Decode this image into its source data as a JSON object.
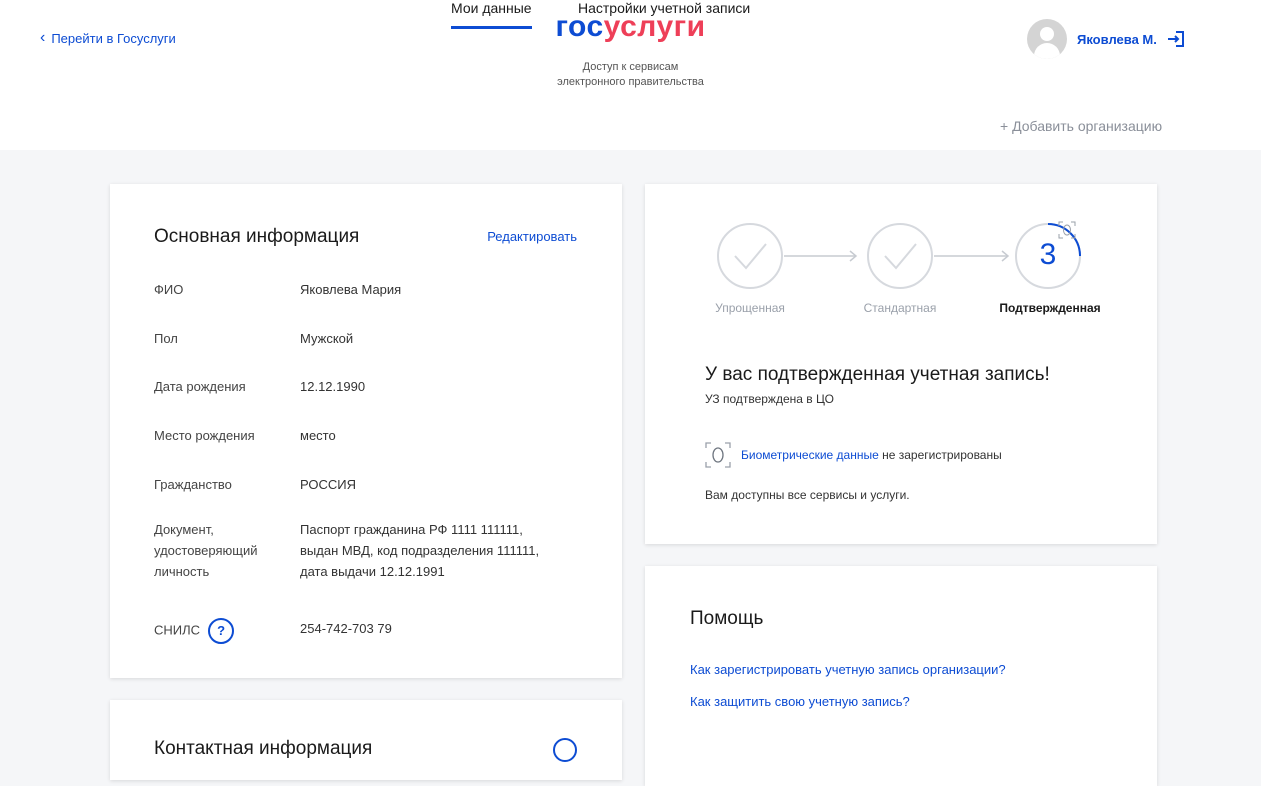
{
  "header": {
    "back_label": "Перейти в Госуслуги",
    "logo_part1": "гос",
    "logo_part2": "услуги",
    "subtitle_line1": "Доступ к сервисам",
    "subtitle_line2": "электронного правительства",
    "user_name": "Яковлева М."
  },
  "tabs": [
    {
      "label": "Мои данные",
      "active": true
    },
    {
      "label": "Настройки учетной записи",
      "active": false
    }
  ],
  "add_org_label": "+ Добавить организацию",
  "main_info": {
    "title": "Основная информация",
    "edit_label": "Редактировать",
    "fields": [
      {
        "label": "ФИО",
        "value": "Яковлева Мария"
      },
      {
        "label": "Пол",
        "value": "Мужской"
      },
      {
        "label": "Дата рождения",
        "value": "12.12.1990"
      },
      {
        "label": "Место рождения",
        "value": "место"
      },
      {
        "label": "Гражданство",
        "value": "РОССИЯ"
      },
      {
        "label": "Документ, удостоверяющий личность",
        "label_lines": [
          "Документ,",
          "удостоверяющий",
          "личность"
        ],
        "value_lines": [
          "Паспорт гражданина РФ 1111 111111,",
          "выдан МВД, код подразделения 111111,",
          "дата выдачи 12.12.1991"
        ]
      },
      {
        "label": "СНИЛС",
        "value": "254-742-703 79"
      }
    ],
    "snils_help": "?"
  },
  "contacts": {
    "title": "Контактная информация"
  },
  "status": {
    "steps": [
      {
        "label": "Упрощенная",
        "done": true
      },
      {
        "label": "Стандартная",
        "done": true
      },
      {
        "label": "Подтвержденная",
        "number": "3",
        "current": true
      }
    ],
    "title": "У вас подтвержденная учетная запись!",
    "subtitle": "УЗ подтверждена в ЦО",
    "bio_link": "Биометрические данные",
    "bio_rest": "не зарегистрированы",
    "all_services": "Вам доступны все сервисы и услуги."
  },
  "help": {
    "title": "Помощь",
    "links": [
      "Как зарегистрировать учетную запись организации?",
      "Как защитить свою учетную запись?"
    ]
  },
  "colors": {
    "accent": "#0d4cd3",
    "logo_red": "#ee3f58",
    "muted": "#9aa0aa"
  }
}
